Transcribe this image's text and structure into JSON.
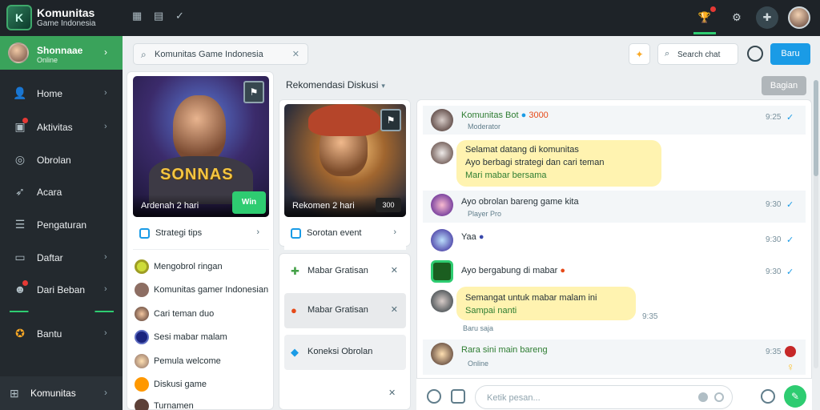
{
  "app": {
    "title": "Komunitas",
    "subtitle": "Game Indonesia"
  },
  "header": {
    "icons": [
      "grid-icon",
      "grid-alt-icon",
      "check-icon"
    ],
    "right_icons": [
      "trophy-icon",
      "settings-icon",
      "shield-icon",
      "user-avatar"
    ]
  },
  "sidebar": {
    "profile": {
      "name": "Shonnaae",
      "sub": "Online"
    },
    "items": [
      {
        "label": "Home",
        "icon": "person-icon",
        "badge": false
      },
      {
        "label": "Aktivitas",
        "icon": "activity-icon",
        "badge": true
      },
      {
        "label": "Obrolan",
        "icon": "chat-icon",
        "badge": false
      },
      {
        "label": "Acara",
        "icon": "rocket-icon",
        "badge": false
      },
      {
        "label": "Pengaturan",
        "icon": "settings-icon",
        "badge": false
      },
      {
        "label": "Daftar",
        "icon": "list-icon",
        "badge": false
      },
      {
        "label": "Dari Beban",
        "icon": "game-icon",
        "badge": true
      },
      {
        "label": "Bantu",
        "icon": "help-icon",
        "badge": false
      }
    ],
    "bottom_label": "Komunitas"
  },
  "search": {
    "value": "Komunitas Game Indonesia"
  },
  "toolbar": {
    "search_small": "Search chat",
    "primary_button": "Baru",
    "gray_button": "Bagian"
  },
  "featured": {
    "hero_title": "SONNAS",
    "hero_caption": "Ardenah 2 hari",
    "hero_badge": "Win",
    "link_label": "Strategi tips",
    "communities": [
      "Mengobrol ringan",
      "Komunitas gamer Indonesian",
      "Cari teman duo",
      "Sesi mabar malam",
      "Pemula welcome",
      "Diskusi game",
      "Turnamen"
    ]
  },
  "middle": {
    "heading": "Rekomendasi Diskusi",
    "hero_caption": "Rekomen 2 hari",
    "hero_badge": "300",
    "link_label": "Sorotan event",
    "items": [
      {
        "label": "Mabar Gratisan",
        "icon": "controller-icon"
      },
      {
        "label": "Mabar Gratisan",
        "icon": "fire-icon"
      },
      {
        "label": "Koneksi Obrolan",
        "icon": "chat-bubble-icon"
      }
    ]
  },
  "chat": {
    "messages": [
      {
        "name": "Komunitas Bot",
        "extra": "3000",
        "sub": "Moderator",
        "time": "9:25"
      },
      {
        "bubble_lines": [
          "Selamat datang di komunitas",
          "Ayo berbagi strategi dan cari teman",
          "Mari mabar bersama"
        ],
        "time": ""
      },
      {
        "text": "Ayo obrolan bareng game kita",
        "sub": "Player Pro",
        "time": "9:30"
      },
      {
        "text": "Yaa",
        "time": "9:30"
      },
      {
        "text": "Ayo bergabung di mabar",
        "time": "9:30"
      },
      {
        "bubble_lines": [
          "Semangat untuk mabar malam ini",
          "Sampai nanti"
        ],
        "sub": "Baru saja",
        "time": "9:35"
      },
      {
        "name": "Rara sini main bareng",
        "sub": "Online",
        "time": "9:35"
      }
    ],
    "composer_placeholder": "Ketik pesan..."
  }
}
